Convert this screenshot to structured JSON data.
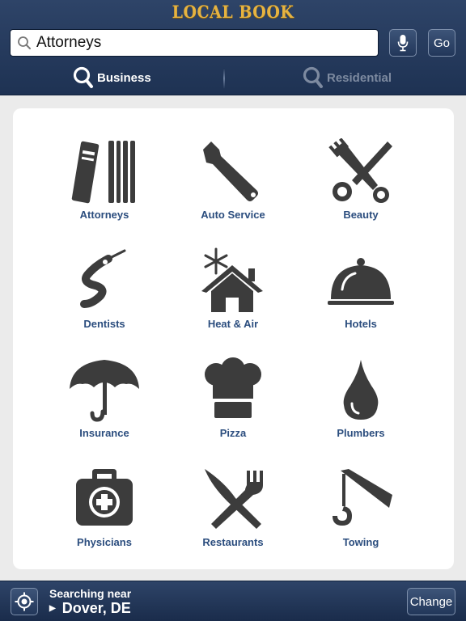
{
  "header": {
    "logo": "LOCAL BOOK",
    "search": {
      "value": "Attorneys",
      "placeholder": ""
    },
    "go_label": "Go",
    "tabs": [
      {
        "label": "Business",
        "active": true
      },
      {
        "label": "Residential",
        "active": false
      }
    ]
  },
  "categories": [
    {
      "label": "Attorneys",
      "icon": "books-icon"
    },
    {
      "label": "Auto Service",
      "icon": "wrench-icon"
    },
    {
      "label": "Beauty",
      "icon": "scissors-comb-icon"
    },
    {
      "label": "Dentists",
      "icon": "floss-icon"
    },
    {
      "label": "Heat & Air",
      "icon": "house-snowflake-icon"
    },
    {
      "label": "Hotels",
      "icon": "cloche-icon"
    },
    {
      "label": "Insurance",
      "icon": "umbrella-icon"
    },
    {
      "label": "Pizza",
      "icon": "chef-hat-icon"
    },
    {
      "label": "Plumbers",
      "icon": "water-drop-icon"
    },
    {
      "label": "Physicians",
      "icon": "medical-kit-icon"
    },
    {
      "label": "Restaurants",
      "icon": "knife-fork-icon"
    },
    {
      "label": "Towing",
      "icon": "tow-hook-icon"
    }
  ],
  "footer": {
    "searching_near_label": "Searching near",
    "location": "Dover, DE",
    "change_label": "Change"
  },
  "colors": {
    "header_bg": "#2a3f62",
    "logo": "#e6b341",
    "category_label": "#2b4d7e",
    "icon": "#3c3c3c"
  }
}
